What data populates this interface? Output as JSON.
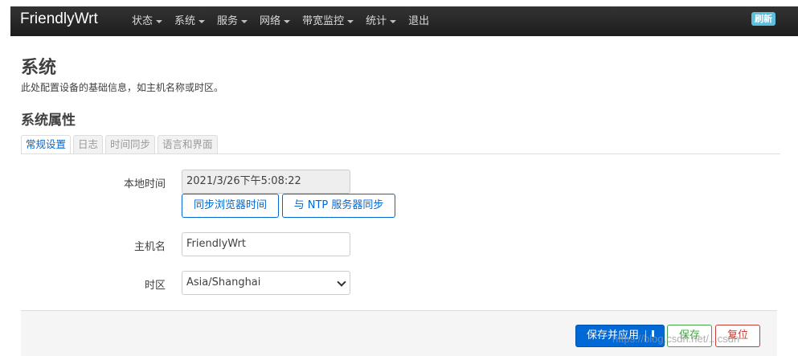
{
  "navbar": {
    "brand": "FriendlyWrt",
    "menu": [
      {
        "label": "状态",
        "dropdown": true
      },
      {
        "label": "系统",
        "dropdown": true
      },
      {
        "label": "服务",
        "dropdown": true
      },
      {
        "label": "网络",
        "dropdown": true
      },
      {
        "label": "带宽监控",
        "dropdown": true
      },
      {
        "label": "统计",
        "dropdown": true
      },
      {
        "label": "退出",
        "dropdown": false
      }
    ],
    "refresh_badge": "刷新"
  },
  "page": {
    "title": "系统",
    "description": "此处配置设备的基础信息，如主机名称或时区。",
    "section_title": "系统属性"
  },
  "tabs": [
    "常规设置",
    "日志",
    "时间同步",
    "语言和界面"
  ],
  "form": {
    "local_time": {
      "label": "本地时间",
      "value": "2021/3/26下午5:08:22",
      "sync_browser_label": "同步浏览器时间",
      "sync_ntp_label": "与 NTP 服务器同步"
    },
    "hostname": {
      "label": "主机名",
      "value": "FriendlyWrt"
    },
    "timezone": {
      "label": "时区",
      "value": "Asia/Shanghai"
    }
  },
  "footer": {
    "save_apply_label": "保存并应用",
    "save_label": "保存",
    "reset_label": "复位"
  },
  "watermark": "https://blog.csdn.net/...csdn",
  "colors": {
    "navbar_bg": "#1f1f1f",
    "accent": "#0069d6",
    "save": "#46a546",
    "reset": "#c43c35",
    "badge": "#5bc0de"
  }
}
